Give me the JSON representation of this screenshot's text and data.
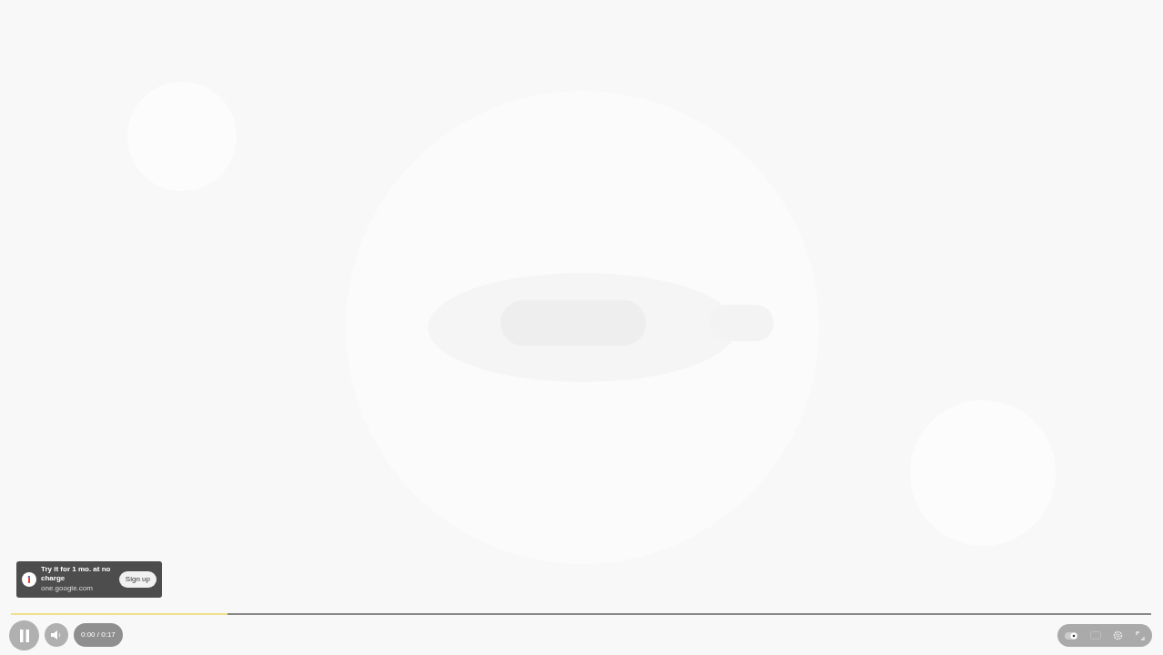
{
  "ad": {
    "title": "Try it for 1 mo. at no charge",
    "domain": "one.google.com",
    "button": "Sign up"
  },
  "progress": {
    "level": 0.19
  },
  "controls": {
    "playing": true,
    "time": "0:00 / 0:17",
    "autoplay": true
  }
}
